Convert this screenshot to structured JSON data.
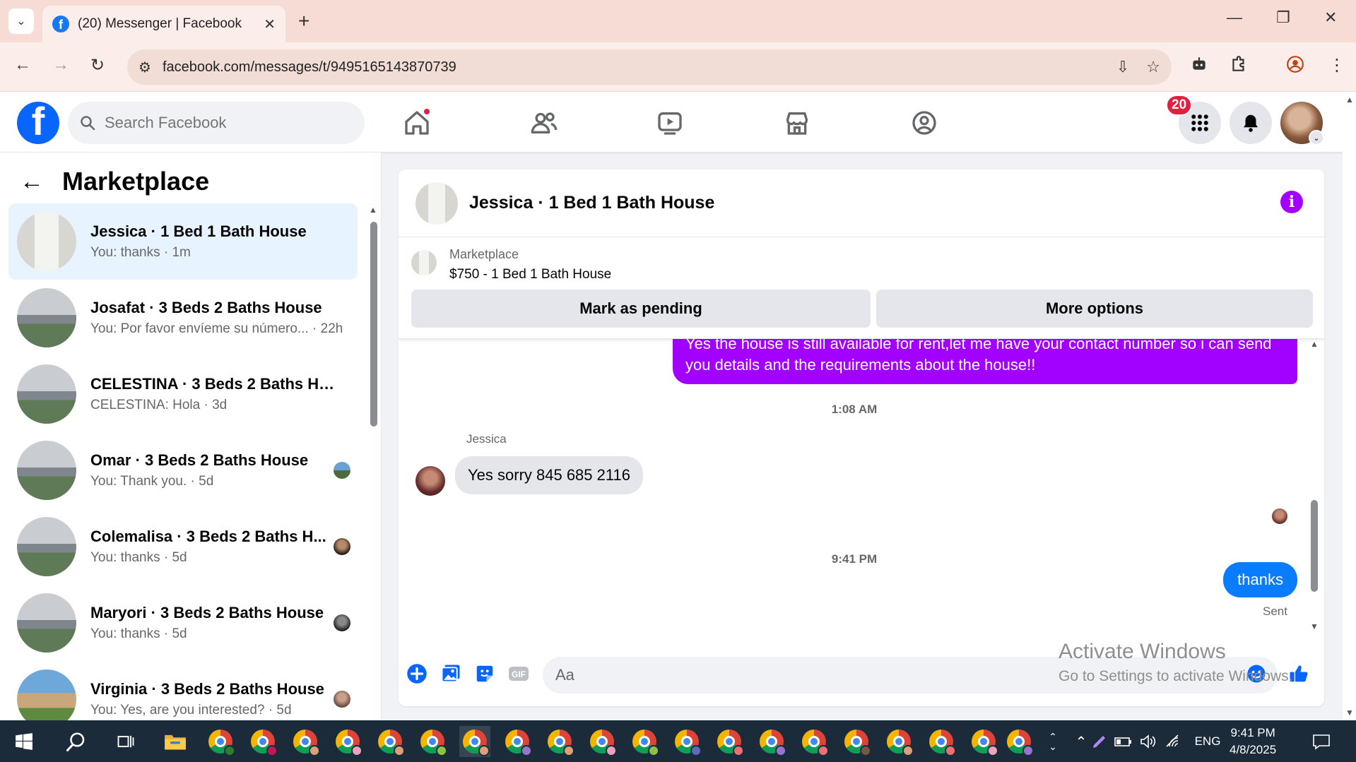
{
  "browser": {
    "tab_title": "(20) Messenger | Facebook",
    "url": "facebook.com/messages/t/9495165143870739"
  },
  "fb": {
    "search_placeholder": "Search Facebook",
    "notification_count": "20",
    "brand_color": "#0866ff"
  },
  "sidebar": {
    "title": "Marketplace",
    "conversations": [
      {
        "name": "Jessica · 1 Bed 1 Bath House",
        "snippet": "You: thanks · 1m",
        "active": true
      },
      {
        "name": "Josafat · 3 Beds 2 Baths House",
        "snippet": "You: Por favor envíeme su número... · 22h"
      },
      {
        "name": "CELESTINA · 3 Beds 2 Baths Hou...",
        "snippet": "CELESTINA: Hola · 3d"
      },
      {
        "name": "Omar · 3 Beds 2 Baths House",
        "snippet": "You: Thank you. · 5d"
      },
      {
        "name": "Colemalisa · 3 Beds 2 Baths H...",
        "snippet": "You: thanks · 5d"
      },
      {
        "name": "Maryori · 3 Beds 2 Baths House",
        "snippet": "You: thanks · 5d"
      },
      {
        "name": "Virginia · 3 Beds 2 Baths House",
        "snippet": "You: Yes, are you interested? · 5d"
      }
    ]
  },
  "chat": {
    "title": "Jessica · 1 Bed 1 Bath House",
    "listing_source": "Marketplace",
    "listing_price": "$750 - 1 Bed 1 Bath House",
    "mark_pending_label": "Mark as pending",
    "more_options_label": "More options",
    "prev_message": "Yes the house is still available for rent,let me have your contact number so i can send you details and the requirements about the house!!",
    "timestamp_1": "1:08 AM",
    "sender_name": "Jessica",
    "incoming_message": "Yes sorry 845 685 2116",
    "timestamp_2": "9:41 PM",
    "outgoing_message": "thanks",
    "sent_status": "Sent",
    "input_placeholder": "Aa",
    "accent_color": "#a200ff",
    "outgoing_color": "#0a7cff"
  },
  "watermark": {
    "line1": "Activate Windows",
    "line2": "Go to Settings to activate Windows."
  },
  "taskbar": {
    "lang": "ENG",
    "time": "9:41 PM",
    "date": "4/8/2025"
  }
}
